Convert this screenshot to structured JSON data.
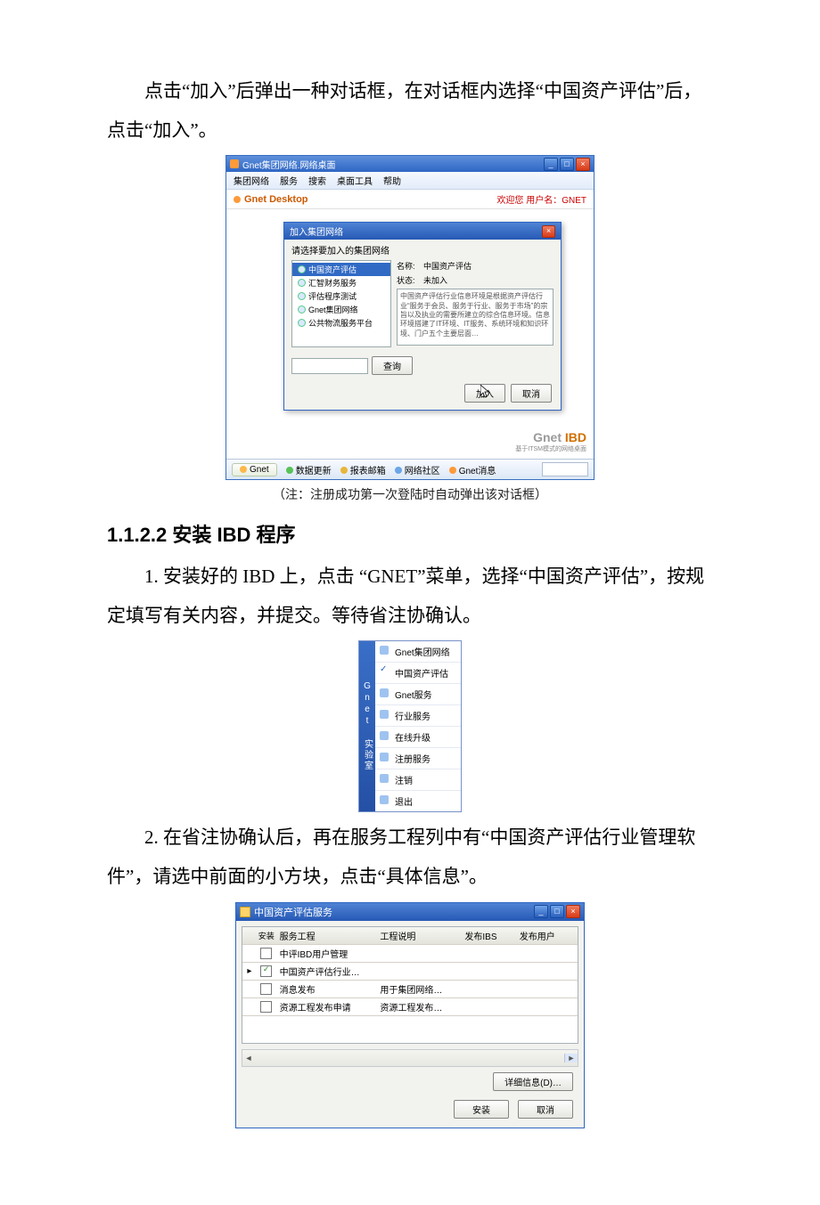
{
  "paragraphs": {
    "p1": "点击“加入”后弹出一种对话框，在对话框内选择“中国资产评估”后，点击“加入”。",
    "caption1": "（注：注册成功第一次登陆时自动弹出该对话框）",
    "heading": "1.1.2.2 安装 IBD 程序",
    "p2": "1. 安装好的 IBD 上，点击 “GNET”菜单，选择“中国资产评估”，按规定填写有关内容，并提交。等待省注协确认。",
    "p3": "2. 在省注协确认后，再在服务工程列中有“中国资产评估行业管理软件”，请选中前面的小方块，点击“具体信息”。"
  },
  "win1": {
    "title": "Gnet集团网络.网络桌面",
    "menu": [
      "集团网络",
      "服务",
      "搜索",
      "桌面工具",
      "帮助"
    ],
    "brand": "Gnet Desktop",
    "welcome": "欢迎您 用户名：GNET",
    "dlg": {
      "title": "加入集团网络",
      "subtitle": "请选择要加入的集团网络",
      "tree": [
        "中国资产评估",
        "汇智财务服务",
        "评估程序测试",
        "Gnet集团网络",
        "公共物流服务平台"
      ],
      "name_label": "名称:",
      "name_value": "中国资产评估",
      "status_label": "状态:",
      "status_value": "未加入",
      "desc": "中国资产评估行业信息环境是根据资产评估行业“服务于会员、服务于行业、服务于市场”的宗旨以及执业的需要所建立的综合信息环境。信息环境搭建了IT环境、IT服务、系统环境和知识环境、门户五个主要层面…",
      "search_btn": "查询",
      "ok_btn": "加入",
      "cancel_btn": "取消"
    },
    "ibd_line1_a": "Gnet ",
    "ibd_line1_b": "IBD",
    "ibd_line2": "基于ITSM模式的网络桌面",
    "task_gnet": "Gnet",
    "task_refresh": "数据更新",
    "task_mail": "报表邮箱",
    "task_comm": "网络社区",
    "task_msg": "Gnet消息"
  },
  "menu2": {
    "side": "Gnet 实验室",
    "items": [
      "Gnet集团网络",
      "中国资产评估",
      "Gnet服务",
      "行业服务",
      "在线升级",
      "注册服务",
      "注销",
      "退出"
    ]
  },
  "win3": {
    "title": "中国资产评估服务",
    "cols": {
      "inst": "安装",
      "name": "服务工程",
      "desc": "工程说明",
      "ibs": "发布IBS",
      "user": "发布用户"
    },
    "rows": [
      {
        "checked": false,
        "name": "中评IBD用户管理",
        "desc": "",
        "ibs": "",
        "user": ""
      },
      {
        "checked": true,
        "name": "中国资产评估行业…",
        "desc": "",
        "ibs": "",
        "user": ""
      },
      {
        "checked": false,
        "name": "消息发布",
        "desc": "用于集团网络…",
        "ibs": "",
        "user": ""
      },
      {
        "checked": false,
        "name": "资源工程发布申请",
        "desc": "资源工程发布…",
        "ibs": "",
        "user": ""
      }
    ],
    "detail_btn": "详细信息(D)…",
    "install_btn": "安装",
    "cancel_btn": "取消"
  }
}
